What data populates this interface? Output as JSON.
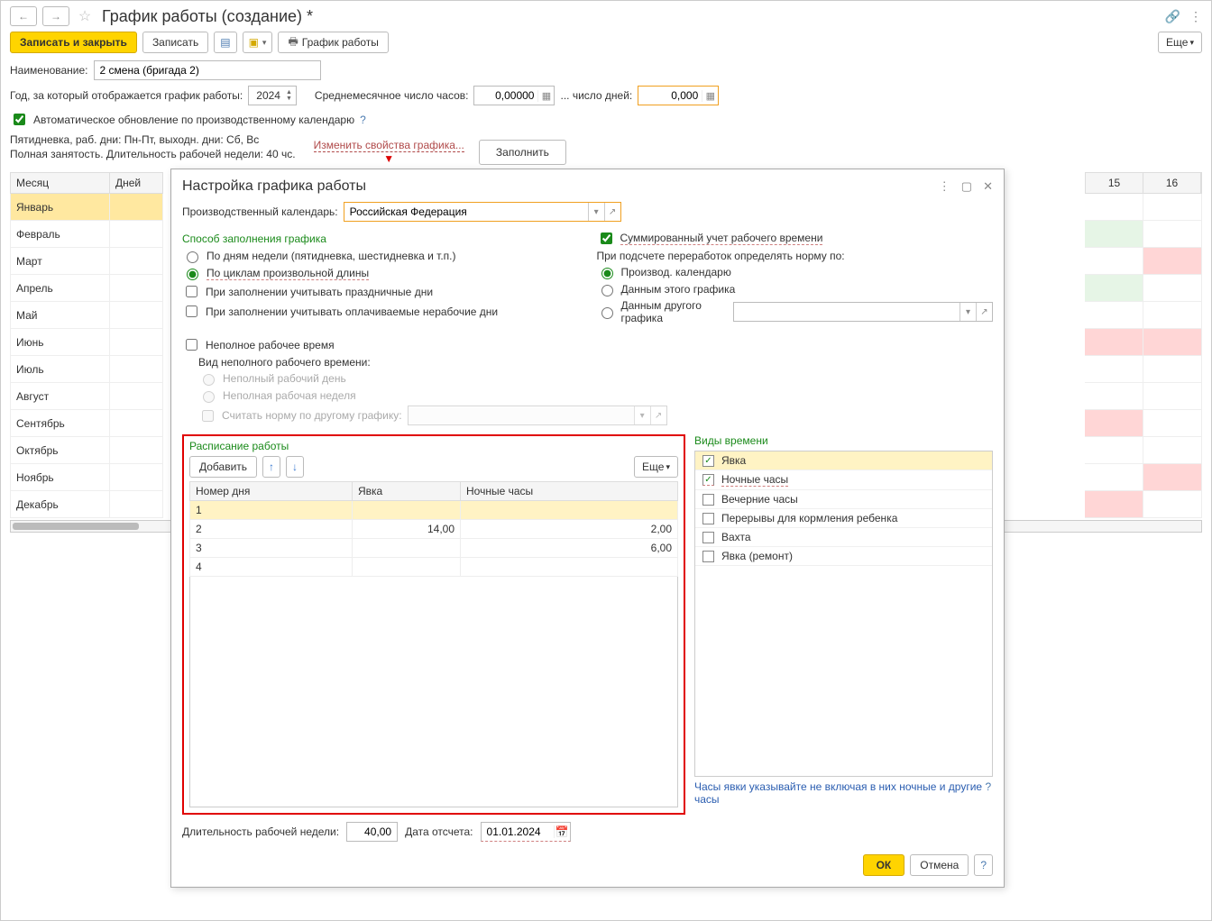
{
  "header": {
    "title": "График работы (создание) *"
  },
  "toolbar": {
    "save_close": "Записать и закрыть",
    "save": "Записать",
    "print": "График работы",
    "more": "Еще"
  },
  "form": {
    "name_label": "Наименование:",
    "name_value": "2 смена (бригада 2)",
    "year_label": "Год, за который отображается график работы:",
    "year_value": "2024",
    "avg_hours_label": "Среднемесячное число часов:",
    "avg_hours_value": "0,00000",
    "days_label": "... число дней:",
    "days_value": "0,000",
    "auto_update_label": "Автоматическое обновление по производственному календарю",
    "static1": "Пятидневка, раб. дни: Пн-Пт, выходн. дни: Сб, Вс",
    "static2": "Полная занятость. Длительность рабочей недели: 40 чс.",
    "change_link": "Изменить свойства графика...",
    "fill_btn": "Заполнить"
  },
  "months": {
    "col_month": "Месяц",
    "col_days": "Дней",
    "items": [
      "Январь",
      "Февраль",
      "Март",
      "Апрель",
      "Май",
      "Июнь",
      "Июль",
      "Август",
      "Сентябрь",
      "Октябрь",
      "Ноябрь",
      "Декабрь"
    ],
    "cal_cols": [
      "15",
      "16"
    ]
  },
  "dialog": {
    "title": "Настройка графика работы",
    "calendar_label": "Производственный календарь:",
    "calendar_value": "Российская Федерация",
    "fill_method_title": "Способ заполнения графика",
    "opt_by_week": "По дням недели (пятидневка, шестидневка и т.п.)",
    "opt_by_cycle": "По циклам произвольной длины",
    "chk_holidays": "При заполнении учитывать праздничные дни",
    "chk_paid_nonwork": "При заполнении учитывать оплачиваемые нерабочие дни",
    "chk_summed": "Суммированный учет рабочего времени",
    "norm_label": "При подсчете переработок определять норму по:",
    "norm_opt1": "Производ. календарю",
    "norm_opt2": "Данным этого графика",
    "norm_opt3": "Данным другого графика",
    "chk_parttime": "Неполное рабочее время",
    "parttime_kind_label": "Вид неполного рабочего времени:",
    "parttime_opt1": "Неполный рабочий день",
    "parttime_opt2": "Неполная рабочая неделя",
    "chk_other_norm": "Считать норму по другому графику:",
    "schedule_title": "Расписание работы",
    "add_btn": "Добавить",
    "more": "Еще",
    "col_dayno": "Номер дня",
    "col_attend": "Явка",
    "col_night": "Ночные часы",
    "rows": [
      {
        "n": "1",
        "a": "",
        "ng": ""
      },
      {
        "n": "2",
        "a": "14,00",
        "ng": "2,00"
      },
      {
        "n": "3",
        "a": "",
        "ng": "6,00"
      },
      {
        "n": "4",
        "a": "",
        "ng": ""
      }
    ],
    "timetypes_title": "Виды времени",
    "timetypes": [
      {
        "label": "Явка",
        "checked": true,
        "sel": true
      },
      {
        "label": "Ночные часы",
        "checked": true,
        "hl": true
      },
      {
        "label": "Вечерние часы",
        "checked": false
      },
      {
        "label": "Перерывы для кормления ребенка",
        "checked": false
      },
      {
        "label": "Вахта",
        "checked": false
      },
      {
        "label": "Явка (ремонт)",
        "checked": false
      }
    ],
    "hint": "Часы явки указывайте не включая в них ночные и другие",
    "hint2": "часы",
    "week_len_label": "Длительность рабочей недели:",
    "week_len_value": "40,00",
    "start_date_label": "Дата отсчета:",
    "start_date_value": "01.01.2024",
    "ok": "ОК",
    "cancel": "Отмена"
  }
}
